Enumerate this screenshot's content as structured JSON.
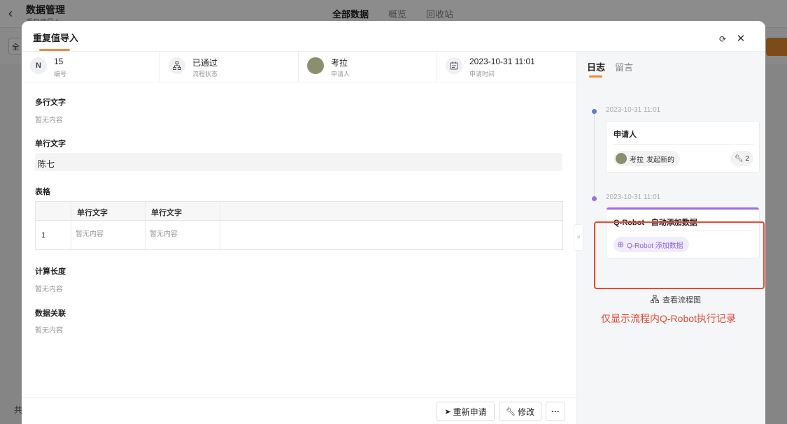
{
  "background": {
    "back_icon": "chevron-left-icon",
    "title": "数据管理",
    "subtitle": "重复值导入",
    "tabs": [
      "全部数据",
      "概览",
      "回收站"
    ],
    "select_partial": "全",
    "footer_partial": "共"
  },
  "modal": {
    "title": "重复值导入",
    "actions": {
      "refresh_icon": "refresh-icon",
      "close_icon": "close-icon"
    },
    "meta": [
      {
        "icon": "id-icon",
        "value": "15",
        "label": "编号"
      },
      {
        "icon": "flow-icon",
        "value": "已通过",
        "label": "流程状态"
      },
      {
        "icon": "avatar",
        "value": "考拉",
        "label": "申请人"
      },
      {
        "icon": "calendar-icon",
        "value": "2023-10-31 11:01",
        "label": "申请时间"
      }
    ],
    "fields": {
      "multiline": {
        "label": "多行文字",
        "value": "暂无内容"
      },
      "singleline": {
        "label": "单行文字",
        "value": "陈七"
      },
      "table": {
        "label": "表格",
        "headers": [
          "单行文字",
          "单行文字"
        ],
        "rows": [
          {
            "index": "1",
            "cells": [
              "暂无内容",
              "暂无内容"
            ]
          }
        ]
      },
      "calc_length": {
        "label": "计算长度",
        "value": "暂无内容"
      },
      "data_link": {
        "label": "数据关联",
        "value": "暂无内容"
      }
    },
    "footer": {
      "reapply": "重新申请",
      "edit": "修改",
      "more": "···"
    }
  },
  "log_panel": {
    "tabs": [
      "日志",
      "留言"
    ],
    "entries": [
      {
        "time": "2023-10-31 11:01",
        "title": "申请人",
        "user": "考拉",
        "action": "发起新的",
        "count": "2",
        "dot_color": "#5b7fd6"
      },
      {
        "time": "2023-10-31 11:01",
        "title": "Q-Robot · 自动添加数据",
        "action": "Q-Robot 添加数据",
        "dot_color": "#9b6fe0"
      }
    ],
    "view_flow": "查看流程图",
    "annotation": "仅显示流程内Q-Robot执行记录"
  },
  "colors": {
    "accent": "#ee8a3b",
    "robot": "#9b6fe0",
    "highlight": "#e54a33"
  }
}
